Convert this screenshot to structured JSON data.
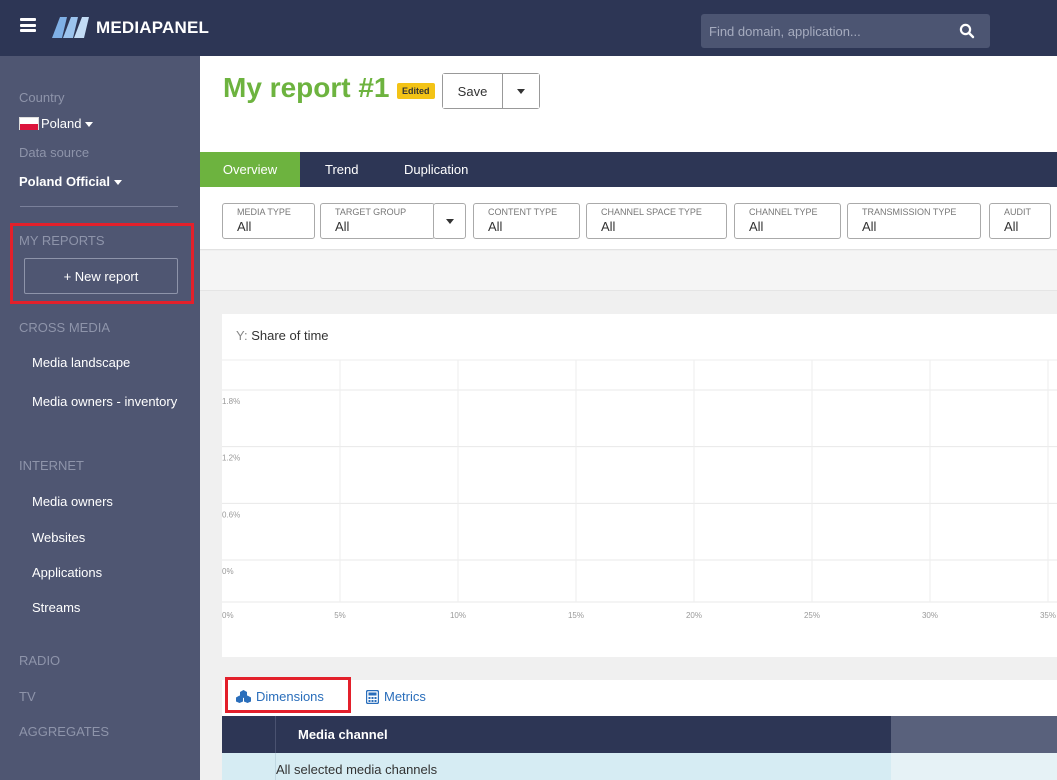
{
  "header": {
    "logo_text": "MEDIAPANEL",
    "search_placeholder": "Find domain, application..."
  },
  "sidebar": {
    "country_label": "Country",
    "country_value": "Poland",
    "datasource_label": "Data source",
    "datasource_value": "Poland Official",
    "my_reports": "MY REPORTS",
    "new_report": "+ New report",
    "sections": [
      {
        "title": "CROSS MEDIA",
        "items": [
          "Media landscape",
          "Media owners - inventory"
        ]
      },
      {
        "title": "INTERNET",
        "items": [
          "Media owners",
          "Websites",
          "Applications",
          "Streams"
        ]
      },
      {
        "title": "RADIO",
        "items": []
      },
      {
        "title": "TV",
        "items": []
      },
      {
        "title": "AGGREGATES",
        "items": []
      }
    ]
  },
  "report": {
    "title": "My report #1",
    "badge": "Edited",
    "save_label": "Save"
  },
  "tabs": [
    "Overview",
    "Trend",
    "Duplication"
  ],
  "active_tab": "Overview",
  "filters": [
    {
      "label": "MEDIA TYPE",
      "value": "All"
    },
    {
      "label": "TARGET GROUP",
      "value": "All"
    },
    {
      "label": "CONTENT TYPE",
      "value": "All"
    },
    {
      "label": "CHANNEL SPACE TYPE",
      "value": "All"
    },
    {
      "label": "CHANNEL TYPE",
      "value": "All"
    },
    {
      "label": "TRANSMISSION TYPE",
      "value": "All"
    },
    {
      "label": "AUDIT",
      "value": "All"
    }
  ],
  "chart_data": {
    "type": "scatter",
    "title": "",
    "ylabel_prefix": "Y:",
    "ylabel": "Share of time",
    "xlabel": "",
    "y_ticks": [
      "1.8%",
      "1.2%",
      "0.6%",
      "0%"
    ],
    "x_ticks": [
      "0%",
      "5%",
      "10%",
      "15%",
      "20%",
      "25%",
      "30%",
      "35%"
    ],
    "ylim": [
      0,
      1.8
    ],
    "xlim": [
      0,
      35
    ],
    "series": [],
    "grid": true
  },
  "bottom_tabs": {
    "dimensions": "Dimensions",
    "metrics": "Metrics"
  },
  "table": {
    "columns": [
      "Media channel"
    ],
    "rows": [
      [
        "All selected media channels"
      ]
    ]
  },
  "colors": {
    "header_bg": "#2d3655",
    "sidebar_bg": "#4f5672",
    "accent_green": "#6db33f",
    "highlight_red": "#e3202b",
    "badge_yellow": "#f3c316",
    "link_blue": "#2a6ebb"
  }
}
